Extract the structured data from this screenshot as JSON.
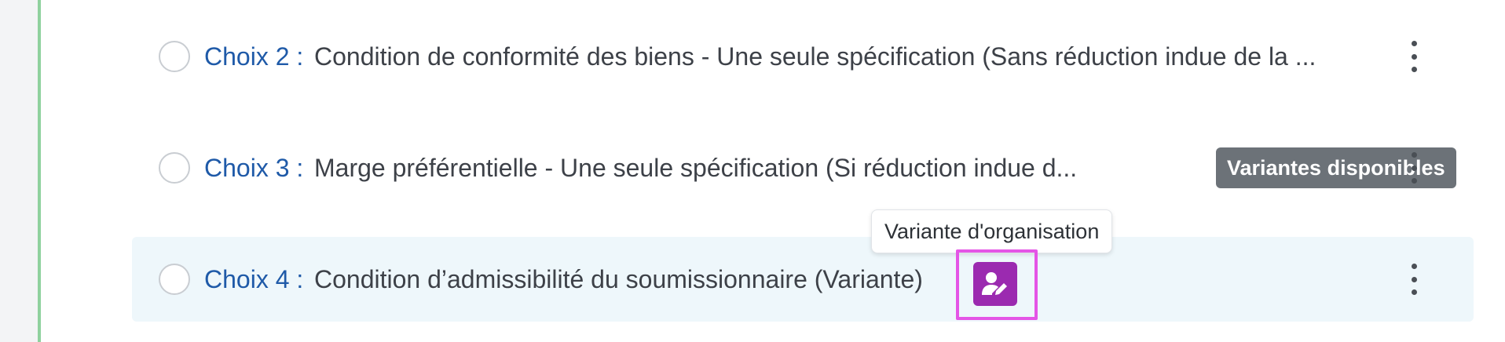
{
  "choices": [
    {
      "label": "Choix 2 :",
      "text": "Condition de conformité des biens - Une seule spécification (Sans réduction indue de la ..."
    },
    {
      "label": "Choix 3 :",
      "text": "Marge préférentielle - Une seule spécification (Si réduction indue d...",
      "badge": "Variantes disponibles"
    },
    {
      "label": "Choix 4 :",
      "text": "Condition d’admissibilité du soumissionnaire (Variante)"
    }
  ],
  "tooltip": "Variante d'organisation",
  "icons": {
    "more": "more-vertical-icon",
    "organisation_variant": "user-edit-icon"
  },
  "colors": {
    "accent_border": "#8fd19e",
    "choice_label": "#1f5aa8",
    "badge_bg": "#6c7278",
    "variant_icon_bg": "#9b2ab0",
    "highlight_outline": "#e455e6",
    "selected_row_bg": "#eef7fb"
  }
}
